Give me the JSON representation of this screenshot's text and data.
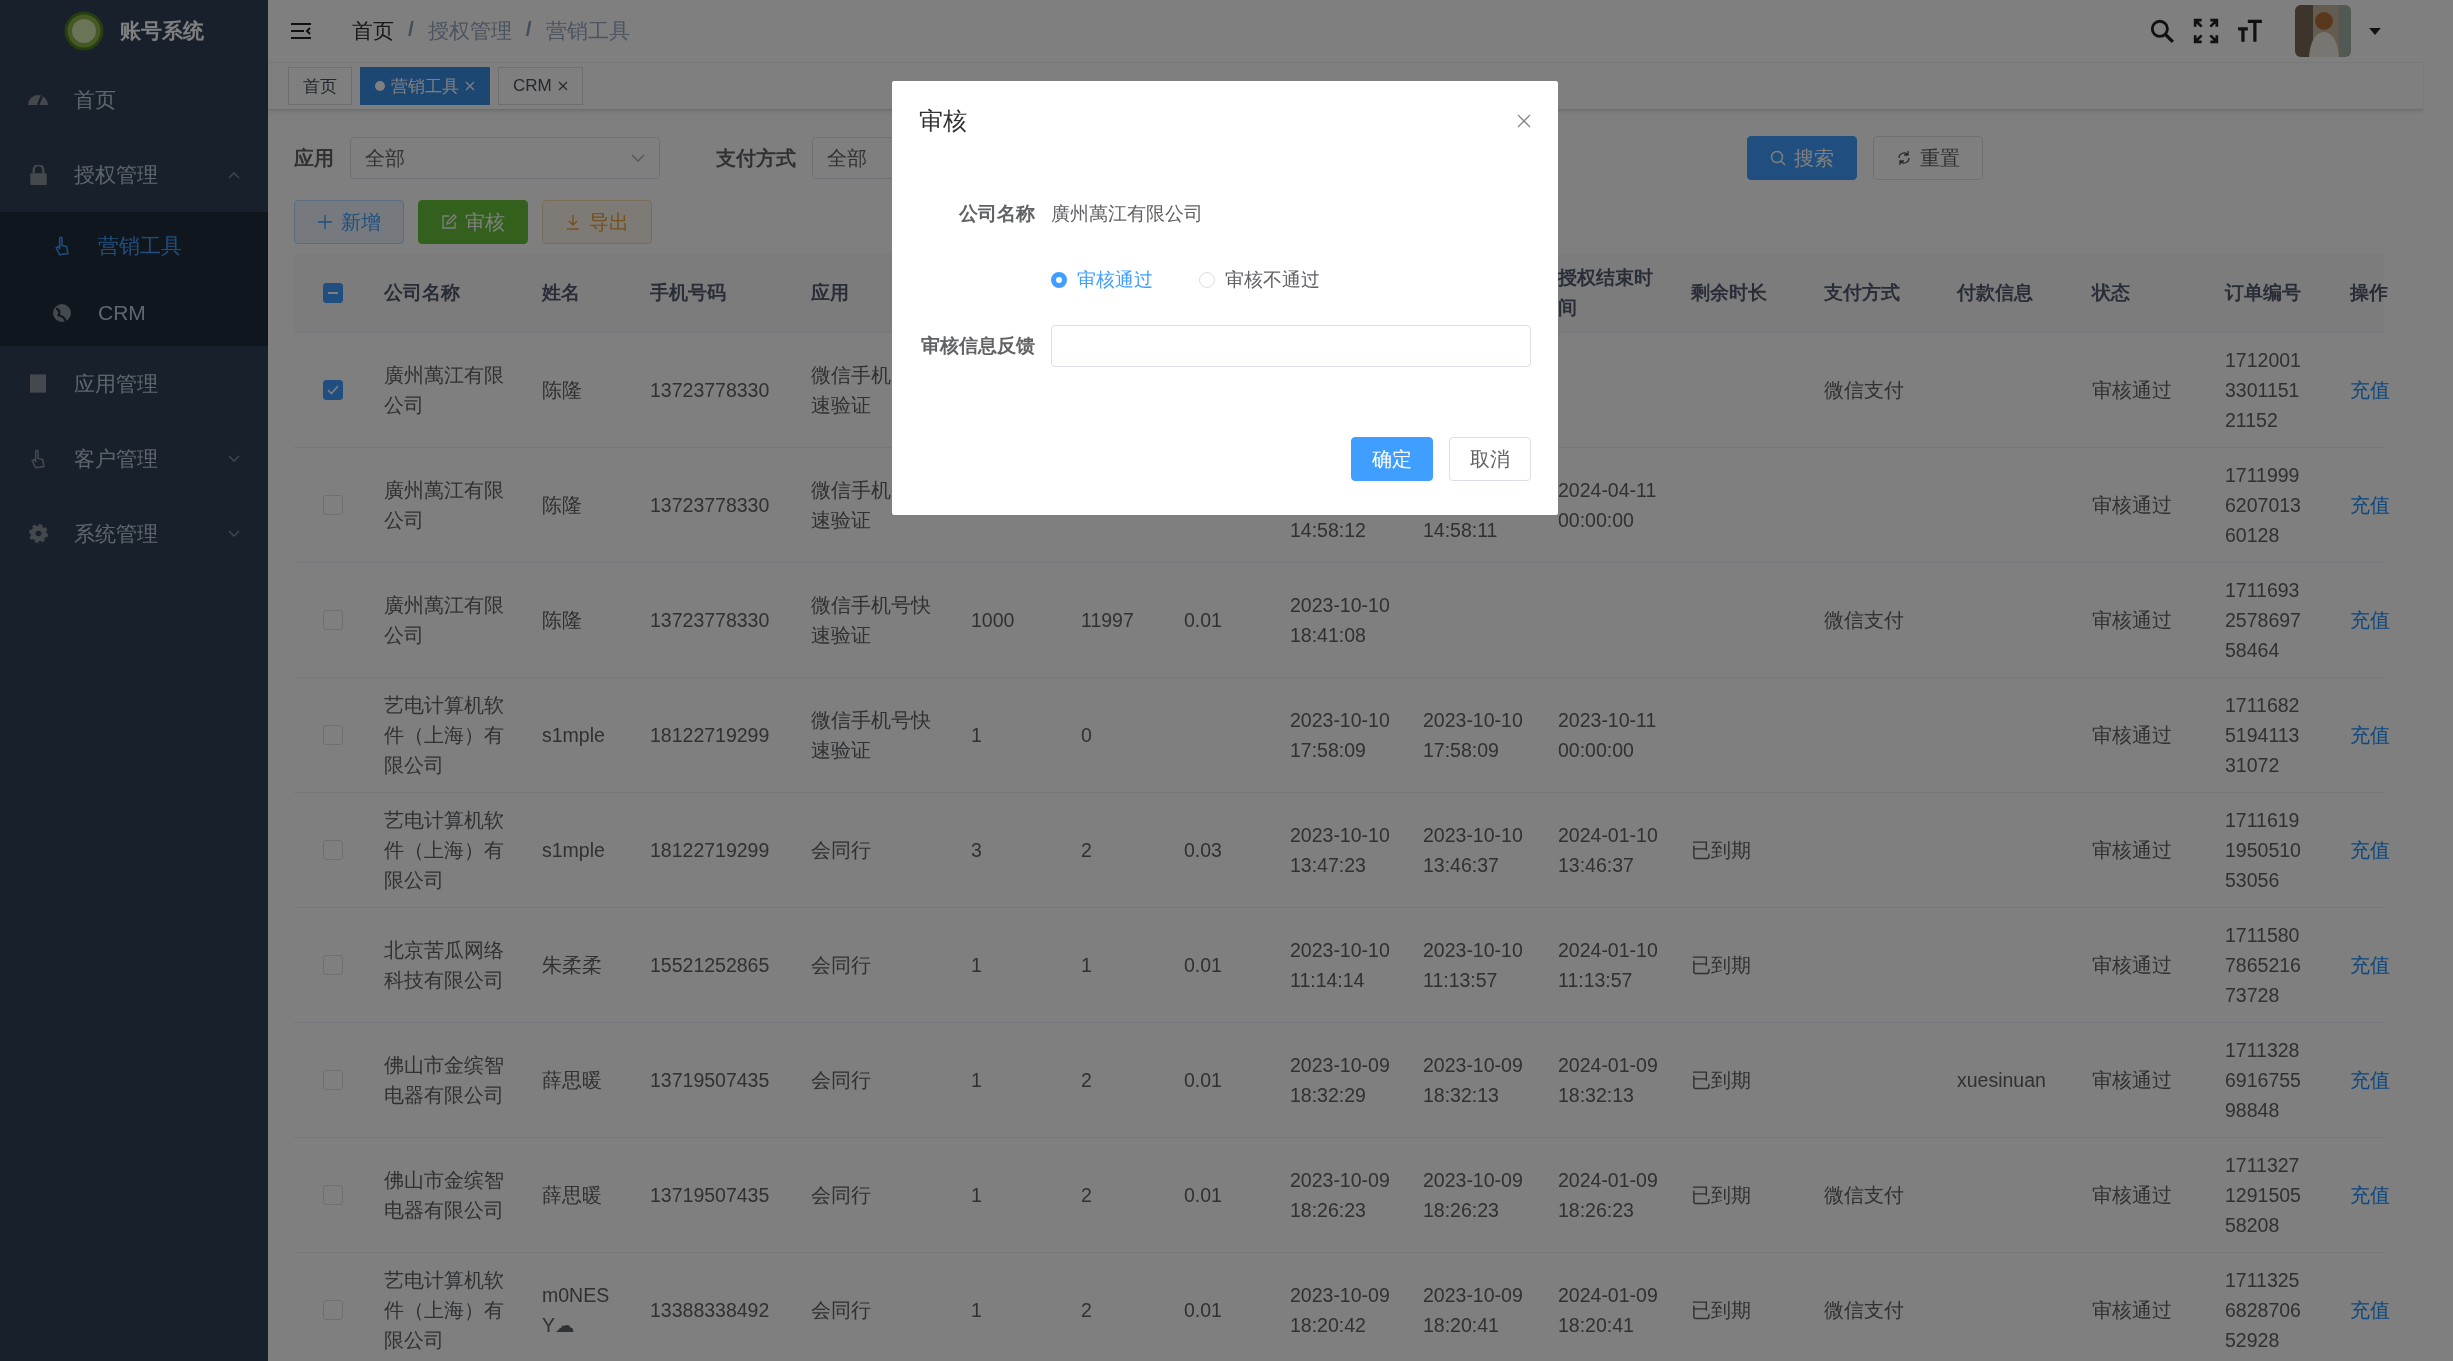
{
  "sidebar": {
    "logo_text": "账号系统",
    "items": [
      {
        "label": "首页"
      },
      {
        "label": "授权管理",
        "expanded": true,
        "children": [
          {
            "label": "营销工具",
            "selected": true
          },
          {
            "label": "CRM",
            "selected": false
          }
        ]
      },
      {
        "label": "应用管理"
      },
      {
        "label": "客户管理",
        "expanded": false
      },
      {
        "label": "系统管理",
        "expanded": false
      }
    ]
  },
  "breadcrumb": [
    "首页",
    "授权管理",
    "营销工具"
  ],
  "breadcrumb_separator": "/",
  "tabs": [
    {
      "label": "首页",
      "selected": false,
      "closable": false
    },
    {
      "label": "营销工具",
      "selected": true,
      "closable": true
    },
    {
      "label": "CRM",
      "selected": false,
      "closable": true
    }
  ],
  "filters": [
    {
      "label": "应用",
      "value": "全部"
    },
    {
      "label": "支付方式",
      "value": "全部"
    }
  ],
  "search_button": "搜索",
  "reset_button": "重置",
  "actions": [
    {
      "kind": "add",
      "label": "新增"
    },
    {
      "kind": "audit",
      "label": "审核"
    },
    {
      "kind": "export",
      "label": "导出"
    }
  ],
  "table": {
    "indeterminate": true,
    "columns": {
      "company": "公司名称",
      "name": "姓名",
      "phone": "手机号码",
      "app": "应用",
      "auth_end": "授权结束时间",
      "remaining": "剩余时长",
      "payment_method": "支付方式",
      "payment_info": "付款信息",
      "status": "状态",
      "order_no": "订单编号",
      "action": "操作"
    },
    "rows": [
      {
        "checked": true,
        "company": "廣州萬江有限公司",
        "name": "陈隆",
        "phone": "13723778330",
        "app": [
          "微信手机",
          "速验证"
        ],
        "payment_method": "微信支付",
        "status": "审核通过",
        "order_no": "1712001330115121152",
        "action": "充值"
      },
      {
        "checked": false,
        "company": "廣州萬江有限公司",
        "name": "陈隆",
        "phone": "13723778330",
        "app": [
          "微信手机",
          "速验证"
        ],
        "column_8": "14:58:12",
        "column_9": "14:58:11",
        "auth_end": "2024-04-11 00:00:00",
        "status": "审核通过",
        "order_no": "1711999620701360128",
        "action": "充值"
      },
      {
        "checked": false,
        "company": "廣州萬江有限公司",
        "name": "陈隆",
        "phone": "13723778330",
        "app": "微信手机号快速验证",
        "column_5": "1000",
        "column_6": "11997",
        "column_7": "0.01",
        "column_8": "2023-10-10 18:41:08",
        "payment_method": "微信支付",
        "status": "审核通过",
        "order_no": "1711693257869758464",
        "action": "充值"
      },
      {
        "checked": false,
        "company": "艺电计算机软件（上海）有限公司",
        "name": "s1mple",
        "phone": "18122719299",
        "app": "微信手机号快速验证",
        "column_5": "1",
        "column_6": "0",
        "column_8": "2023-10-10 17:58:09",
        "column_9": "2023-10-10 17:58:09",
        "auth_end": "2023-10-11 00:00:00",
        "status": "审核通过",
        "order_no": "1711682519411331072",
        "action": "充值"
      },
      {
        "checked": false,
        "company": "艺电计算机软件（上海）有限公司",
        "name": "s1mple",
        "phone": "18122719299",
        "app": "会同行",
        "column_5": "3",
        "column_6": "2",
        "column_7": "0.03",
        "column_8": "2023-10-10 13:47:23",
        "column_9": "2023-10-10 13:46:37",
        "auth_end": "2024-01-10 13:46:37",
        "remaining": "已到期",
        "status": "审核通过",
        "order_no": "1711619195051053056",
        "action": "充值"
      },
      {
        "checked": false,
        "company": "北京苦瓜网络科技有限公司",
        "name": "朱柔柔",
        "phone": "15521252865",
        "app": "会同行",
        "column_5": "1",
        "column_6": "1",
        "column_7": "0.01",
        "column_8": "2023-10-10 11:14:14",
        "column_9": "2023-10-10 11:13:57",
        "auth_end": "2024-01-10 11:13:57",
        "remaining": "已到期",
        "status": "审核通过",
        "order_no": "1711580786521673728",
        "action": "充值"
      },
      {
        "checked": false,
        "company": "佛山市金缤智电器有限公司",
        "name": "薛思暖",
        "phone": "13719507435",
        "app": "会同行",
        "column_5": "1",
        "column_6": "2",
        "column_7": "0.01",
        "column_8": "2023-10-09 18:32:29",
        "column_9": "2023-10-09 18:32:13",
        "auth_end": "2024-01-09 18:32:13",
        "remaining": "已到期",
        "payment_info": "xuesinuan",
        "status": "审核通过",
        "order_no": "1711328691675598848",
        "action": "充值"
      },
      {
        "checked": false,
        "company": "佛山市金缤智电器有限公司",
        "name": "薛思暖",
        "phone": "13719507435",
        "app": "会同行",
        "column_5": "1",
        "column_6": "2",
        "column_7": "0.01",
        "column_8": "2023-10-09 18:26:23",
        "column_9": "2023-10-09 18:26:23",
        "auth_end": "2024-01-09 18:26:23",
        "remaining": "已到期",
        "payment_method": "微信支付",
        "status": "审核通过",
        "order_no": "1711327129150558208",
        "action": "充值"
      },
      {
        "checked": false,
        "company": "艺电计算机软件（上海）有限公司",
        "name": "m0NESY☁",
        "phone": "13388338492",
        "app": "会同行",
        "column_5": "1",
        "column_6": "2",
        "column_7": "0.01",
        "column_8": "2023-10-09 18:20:42",
        "column_9": "2023-10-09 18:20:41",
        "auth_end": "2024-01-09 18:20:41",
        "remaining": "已到期",
        "payment_method": "微信支付",
        "status": "审核通过",
        "order_no": "1711325682870652928",
        "action": "充值"
      }
    ]
  },
  "dialog": {
    "title": "审核",
    "company_label": "公司名称",
    "company_value": "廣州萬江有限公司",
    "options": [
      {
        "label": "审核通过",
        "selected": true
      },
      {
        "label": "审核不通过",
        "selected": false
      }
    ],
    "feedback_label": "审核信息反馈",
    "confirm": "确定",
    "cancel": "取消"
  }
}
